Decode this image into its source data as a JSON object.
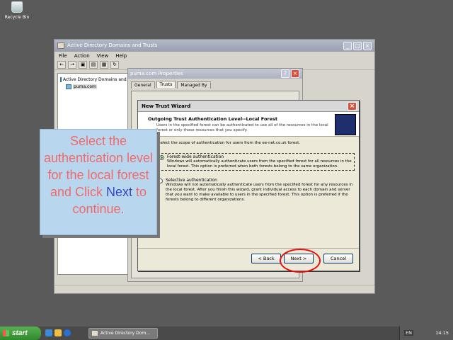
{
  "desktop": {
    "recycle_label": "Recycle Bin"
  },
  "window": {
    "title": "Active Directory Domains and Trusts",
    "menu": [
      "File",
      "Action",
      "View",
      "Help"
    ],
    "tree": [
      "Active Directory Domains and",
      "puma.com"
    ]
  },
  "props": {
    "title": "puma.com Properties",
    "tabs": [
      "General",
      "Trusts",
      "Managed By"
    ]
  },
  "wizard": {
    "title": "New Trust Wizard",
    "heading": "Outgoing Trust Authentication Level--Local Forest",
    "subheading": "Users in the specified forest can be authenticated to use all of the resources in the local forest or only those resources that you specify.",
    "scope_text": "Select the scope of authentication for users from the ee-net.co.uk forest.",
    "option1_title": "Forest-wide authentication",
    "option1_desc": "Windows will automatically authenticate users from the specified forest for all resources in the local forest. This option is preferred when both forests belong to the same organization.",
    "option2_title": "Selective authentication",
    "option2_desc": "Windows will not automatically authenticate users from the specified forest for any resources in the local forest. After you finish this wizard, grant individual access to each domain and server that you want to make available to users in the specified forest. This option is preferred if the forests belong to different organizations.",
    "back_label": "< Back",
    "next_label": "Next >",
    "cancel_label": "Cancel",
    "selected_option": "Forest-wide authentication"
  },
  "callout": {
    "text_before": "Select the authentication level for the local forest and Click",
    "next_word": "Next",
    "text_after": "to continue."
  },
  "taskbar": {
    "start_label": "start",
    "task_label": "Active Directory Dom...",
    "lang": "EN",
    "clock": "14:15"
  },
  "colors": {
    "callout_bg": "#b9d6ef",
    "callout_text": "#f06a6a",
    "callout_next": "#3348c5",
    "ring": "#e60d0d"
  }
}
